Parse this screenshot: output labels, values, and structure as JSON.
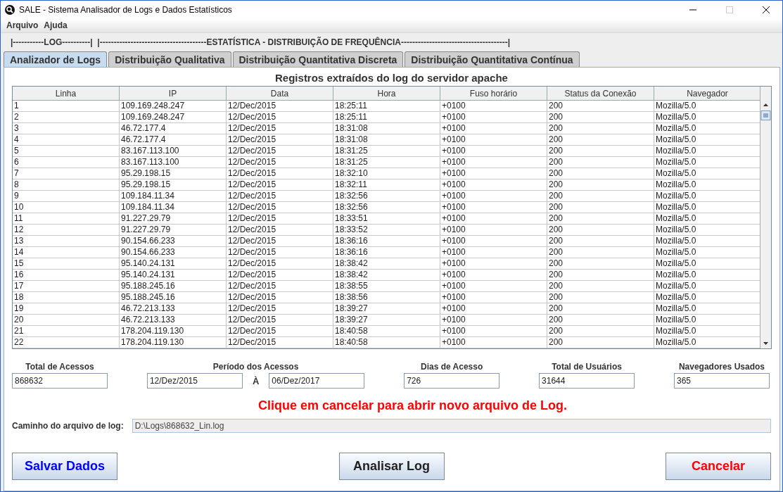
{
  "window": {
    "title": "SALE - Sistema Analisador de Logs e Dados Estatísticos"
  },
  "menu": [
    "Arquivo",
    "Ajuda"
  ],
  "section_header": "|-----------LOG----------|  |--------------------------------------ESTATÍSTICA - DISTRIBUIÇÃO DE FREQUÊNCIA--------------------------------------|",
  "tabs": [
    {
      "label": "Analizador de Logs",
      "selected": true
    },
    {
      "label": "Distribuição Qualitativa",
      "selected": false
    },
    {
      "label": "Distribuição Quantitativa Discreta",
      "selected": false
    },
    {
      "label": "Distribuição Quantitativa Contínua",
      "selected": false
    }
  ],
  "table": {
    "title": "Registros extraídos do log do servidor apache",
    "columns": [
      "Linha",
      "IP",
      "Data",
      "Hora",
      "Fuso horário",
      "Status da Conexão",
      "Navegador"
    ],
    "rows": [
      [
        "1",
        "109.169.248.247",
        "12/Dec/2015",
        "18:25:11",
        "+0100",
        "200",
        "Mozilla/5.0"
      ],
      [
        "2",
        "109.169.248.247",
        "12/Dec/2015",
        "18:25:11",
        "+0100",
        "200",
        "Mozilla/5.0"
      ],
      [
        "3",
        "46.72.177.4",
        "12/Dec/2015",
        "18:31:08",
        "+0100",
        "200",
        "Mozilla/5.0"
      ],
      [
        "4",
        "46.72.177.4",
        "12/Dec/2015",
        "18:31:08",
        "+0100",
        "200",
        "Mozilla/5.0"
      ],
      [
        "5",
        "83.167.113.100",
        "12/Dec/2015",
        "18:31:25",
        "+0100",
        "200",
        "Mozilla/5.0"
      ],
      [
        "6",
        "83.167.113.100",
        "12/Dec/2015",
        "18:31:25",
        "+0100",
        "200",
        "Mozilla/5.0"
      ],
      [
        "7",
        "95.29.198.15",
        "12/Dec/2015",
        "18:32:10",
        "+0100",
        "200",
        "Mozilla/5.0"
      ],
      [
        "8",
        "95.29.198.15",
        "12/Dec/2015",
        "18:32:11",
        "+0100",
        "200",
        "Mozilla/5.0"
      ],
      [
        "9",
        "109.184.11.34",
        "12/Dec/2015",
        "18:32:56",
        "+0100",
        "200",
        "Mozilla/5.0"
      ],
      [
        "10",
        "109.184.11.34",
        "12/Dec/2015",
        "18:32:56",
        "+0100",
        "200",
        "Mozilla/5.0"
      ],
      [
        "11",
        "91.227.29.79",
        "12/Dec/2015",
        "18:33:51",
        "+0100",
        "200",
        "Mozilla/5.0"
      ],
      [
        "12",
        "91.227.29.79",
        "12/Dec/2015",
        "18:33:52",
        "+0100",
        "200",
        "Mozilla/5.0"
      ],
      [
        "13",
        "90.154.66.233",
        "12/Dec/2015",
        "18:36:16",
        "+0100",
        "200",
        "Mozilla/5.0"
      ],
      [
        "14",
        "90.154.66.233",
        "12/Dec/2015",
        "18:36:16",
        "+0100",
        "200",
        "Mozilla/5.0"
      ],
      [
        "15",
        "95.140.24.131",
        "12/Dec/2015",
        "18:38:42",
        "+0100",
        "200",
        "Mozilla/5.0"
      ],
      [
        "16",
        "95.140.24.131",
        "12/Dec/2015",
        "18:38:42",
        "+0100",
        "200",
        "Mozilla/5.0"
      ],
      [
        "17",
        "95.188.245.16",
        "12/Dec/2015",
        "18:38:55",
        "+0100",
        "200",
        "Mozilla/5.0"
      ],
      [
        "18",
        "95.188.245.16",
        "12/Dec/2015",
        "18:38:56",
        "+0100",
        "200",
        "Mozilla/5.0"
      ],
      [
        "19",
        "46.72.213.133",
        "12/Dec/2015",
        "18:39:27",
        "+0100",
        "200",
        "Mozilla/5.0"
      ],
      [
        "20",
        "46.72.213.133",
        "12/Dec/2015",
        "18:39:27",
        "+0100",
        "200",
        "Mozilla/5.0"
      ],
      [
        "21",
        "178.204.119.130",
        "12/Dec/2015",
        "18:40:58",
        "+0100",
        "200",
        "Mozilla/5.0"
      ],
      [
        "22",
        "178.204.119.130",
        "12/Dec/2015",
        "18:40:58",
        "+0100",
        "200",
        "Mozilla/5.0"
      ]
    ]
  },
  "stats": [
    {
      "kind": "single",
      "label": "Total de Acessos",
      "values": [
        "868632"
      ]
    },
    {
      "kind": "range",
      "label": "Período dos Acessos",
      "values": [
        "12/Dez/2015",
        "06/Dez/2017"
      ],
      "separator": "À"
    },
    {
      "kind": "single",
      "label": "Dias de Acesso",
      "values": [
        "726"
      ]
    },
    {
      "kind": "single",
      "label": "Total de Usuários",
      "values": [
        "31644"
      ]
    },
    {
      "kind": "single",
      "label": "Navegadores Usados",
      "values": [
        "365"
      ]
    }
  ],
  "message": "Clique em cancelar para abrir novo arquivo de Log.",
  "log_path": {
    "label": "Caminho do arquivo de log:",
    "value": "D:\\Logs\\868632_Lin.log"
  },
  "buttons": [
    {
      "label": "Salvar Dados",
      "kind": "save"
    },
    {
      "label": "Analisar Log",
      "kind": "analyze"
    },
    {
      "label": "Cancelar",
      "kind": "cancel"
    }
  ]
}
